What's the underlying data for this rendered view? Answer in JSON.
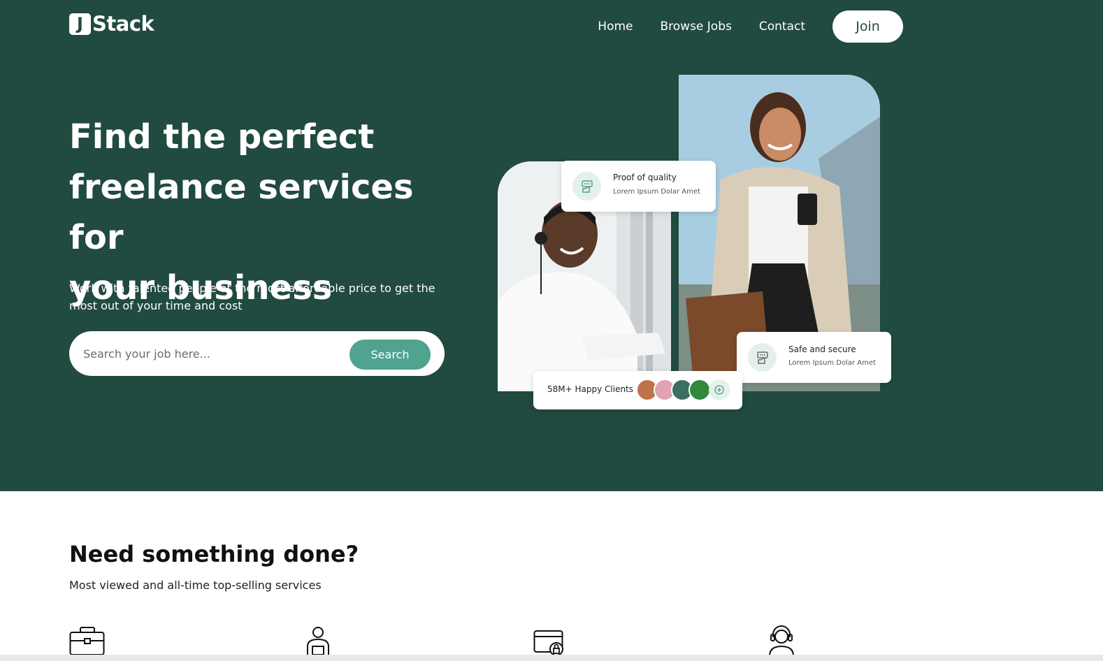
{
  "brand": {
    "logo_letter": "J",
    "name": "Stack"
  },
  "nav": {
    "items": [
      "Home",
      "Browse Jobs",
      "Contact"
    ],
    "join_label": "Join"
  },
  "hero": {
    "headline_lines": [
      "Find the perfect",
      "freelance services for",
      "your business"
    ],
    "subtitle": "Work with talented people at the most affordable price to get the most out of your time and cost",
    "search_placeholder": "Search your job here...",
    "search_button": "Search"
  },
  "cards": {
    "quality": {
      "title": "Proof of quality",
      "text": "Lorem Ipsum Dolar Amet"
    },
    "safe": {
      "title": "Safe and secure",
      "text": "Lorem Ipsum Dolar Amet"
    },
    "clients": {
      "label": "58M+ Happy Clients"
    }
  },
  "section": {
    "title": "Need something done?",
    "subtitle": "Most viewed and all-time top-selling services"
  },
  "services_icons": [
    "briefcase-icon",
    "person-laptop-icon",
    "secure-payment-icon",
    "support-agent-icon"
  ],
  "colors": {
    "hero_bg": "#214a40",
    "accent": "#4fa38f",
    "badge_bg": "#e3f1ea"
  }
}
